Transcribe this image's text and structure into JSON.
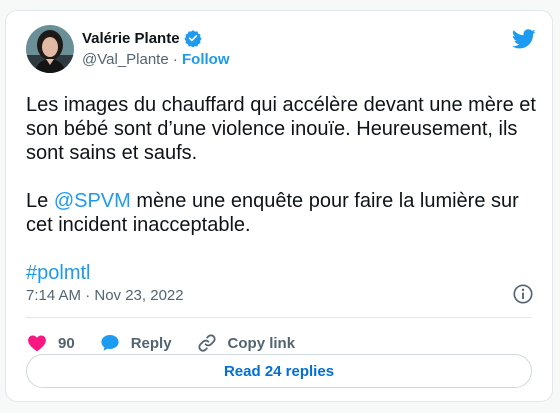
{
  "author": {
    "name": "Valérie Plante",
    "handle": "@Val_Plante",
    "separator": "·",
    "follow_label": "Follow"
  },
  "tweet": {
    "text_part1": "Les images du chauffard qui accélère devant une mère et son bébé sont d’une violence inouïe. Heureusement, ils sont sains et saufs.",
    "text_part2_prefix": "Le ",
    "mention": "@SPVM",
    "text_part2_suffix": " mène une enquête pour faire la lumière sur cet incident inacceptable.",
    "hashtag": "#polmtl",
    "timestamp": "7:14 AM · Nov 23, 2022"
  },
  "actions": {
    "likes_count": "90",
    "reply_label": "Reply",
    "copy_link_label": "Copy link"
  },
  "read_replies_label": "Read 24 replies",
  "colors": {
    "accent": "#1d9bf0",
    "heart": "#f91880",
    "text": "#0f1419",
    "muted": "#536471"
  },
  "icons": [
    "verified-badge-icon",
    "twitter-bird-icon",
    "info-icon",
    "heart-icon",
    "reply-bubble-icon",
    "link-icon"
  ]
}
